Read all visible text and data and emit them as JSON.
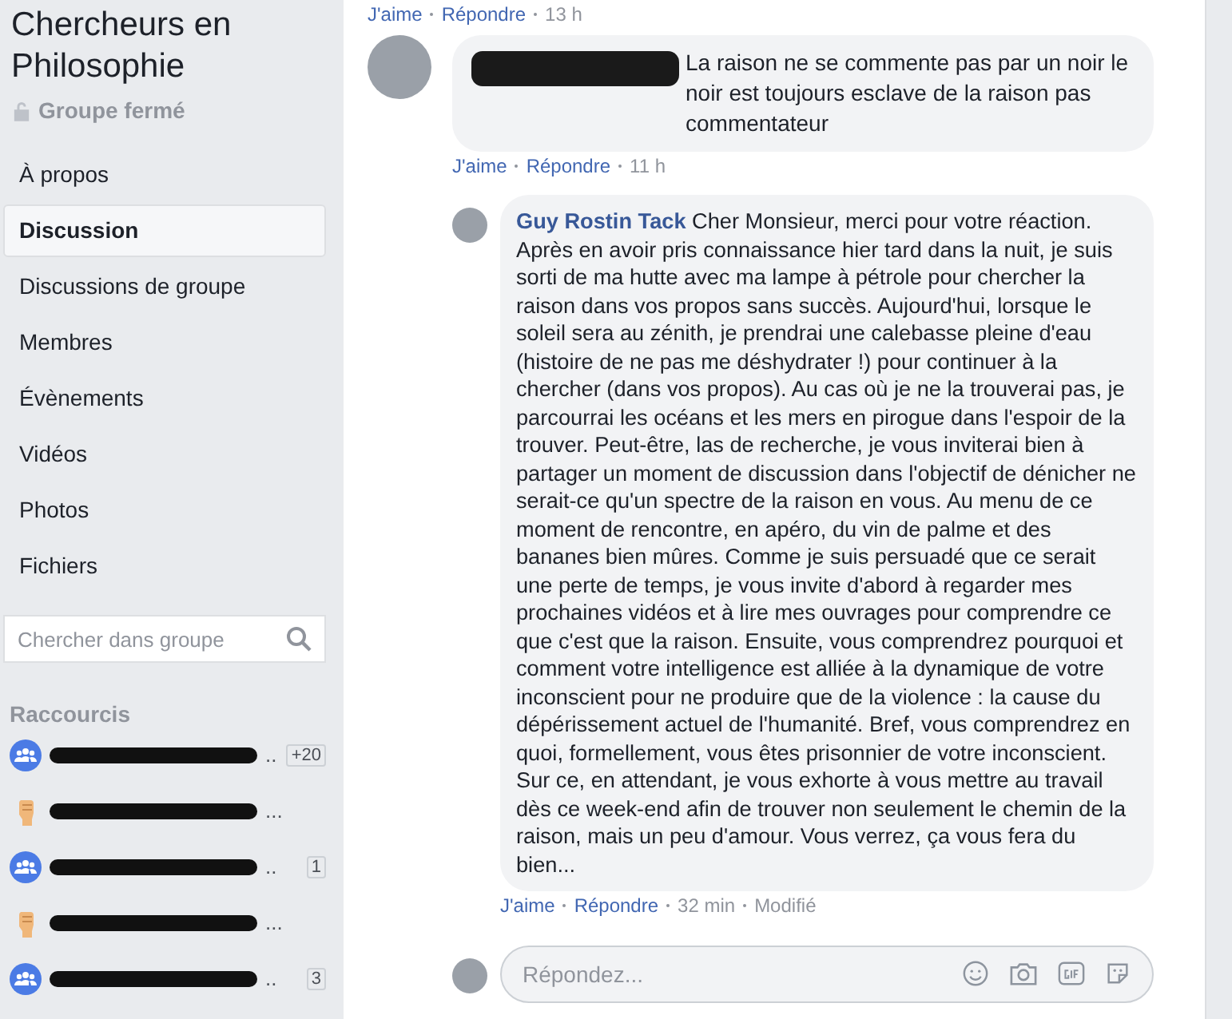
{
  "group": {
    "title": "Chercheurs en Philosophie",
    "privacy": "Groupe fermé"
  },
  "nav": [
    {
      "label": "À propos",
      "selected": false
    },
    {
      "label": "Discussion",
      "selected": true
    },
    {
      "label": "Discussions de groupe",
      "selected": false
    },
    {
      "label": "Membres",
      "selected": false
    },
    {
      "label": "Évènements",
      "selected": false
    },
    {
      "label": "Vidéos",
      "selected": false
    },
    {
      "label": "Photos",
      "selected": false
    },
    {
      "label": "Fichiers",
      "selected": false
    }
  ],
  "search": {
    "placeholder": "Chercher dans groupe"
  },
  "shortcuts": {
    "heading": "Raccourcis",
    "items": [
      {
        "kind": "group",
        "tail": "..",
        "badge": "+20"
      },
      {
        "kind": "fist",
        "tail": "..."
      },
      {
        "kind": "group",
        "tail": "..",
        "badge": "1"
      },
      {
        "kind": "fist",
        "tail": "..."
      },
      {
        "kind": "group",
        "tail": "..",
        "badge": "3"
      }
    ]
  },
  "previous_actions": {
    "like": "J'aime",
    "reply": "Répondre",
    "time": "13 h"
  },
  "comment": {
    "text": "La raison ne se commente pas par un noir le noir est toujours esclave de la raison pas commentateur",
    "actions": {
      "like": "J'aime",
      "reply": "Répondre",
      "time": "11 h"
    }
  },
  "reply": {
    "author": "Guy Rostin Tack",
    "text": "Cher Monsieur, merci pour votre réaction. Après en avoir pris connaissance hier tard dans la nuit, je suis sorti de ma hutte avec ma lampe à pétrole pour chercher la raison dans vos propos sans succès. Aujourd'hui, lorsque le soleil sera au zénith, je prendrai une calebasse pleine d'eau (histoire de ne pas me déshydrater !) pour continuer à la chercher (dans vos propos). Au cas où je ne la trouverai pas, je parcourrai les océans et les mers en pirogue dans l'espoir de la trouver. Peut-être, las de recherche, je vous inviterai bien à partager un moment de discussion dans l'objectif de dénicher ne serait-ce qu'un spectre de la raison en vous. Au menu de ce moment de rencontre, en apéro, du vin de palme et des bananes bien mûres. Comme je suis persuadé que ce serait une perte de temps, je vous invite d'abord à regarder mes prochaines vidéos et à lire mes ouvrages pour comprendre ce que c'est que la raison. Ensuite, vous comprendrez pourquoi et comment votre intelligence est alliée à la dynamique de votre inconscient pour ne produire que de la violence : la cause du dépérissement actuel de l'humanité. Bref, vous comprendrez en quoi, formellement, vous êtes prisonnier de votre inconscient. Sur ce, en attendant, je vous exhorte à vous mettre au travail dès ce week-end afin de trouver non seulement le chemin de la raison, mais un peu d'amour. Vous verrez, ça vous fera du bien...",
    "actions": {
      "like": "J'aime",
      "reply": "Répondre",
      "time": "32 min",
      "edited": "Modifié"
    }
  },
  "composer": {
    "placeholder": "Répondez..."
  }
}
